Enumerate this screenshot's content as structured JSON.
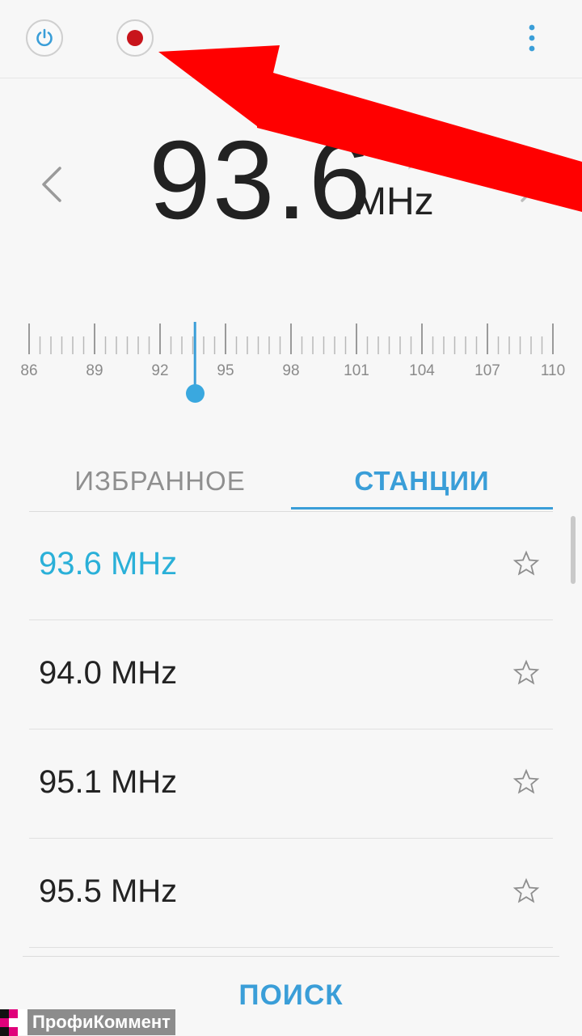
{
  "toolbar": {
    "power_icon": "power-icon",
    "record_icon": "record-icon",
    "more_icon": "more-vertical-icon"
  },
  "tuner": {
    "frequency": "93.6",
    "unit": "MHz",
    "scale_labels": [
      "86",
      "89",
      "92",
      "95",
      "98",
      "101",
      "104",
      "107",
      "110"
    ],
    "scale_min": 86,
    "scale_max": 110,
    "current": 93.6,
    "accent": "#3a9ed8"
  },
  "tabs": {
    "favorites": "ИЗБРАННОЕ",
    "stations": "СТАНЦИИ",
    "selected": "stations"
  },
  "stations": [
    {
      "label": "93.6 MHz",
      "active": true
    },
    {
      "label": "94.0 MHz",
      "active": false
    },
    {
      "label": "95.1 MHz",
      "active": false
    },
    {
      "label": "95.5 MHz",
      "active": false
    }
  ],
  "footer": {
    "search_label": "ПОИСК"
  },
  "watermark": {
    "text": "ПрофиКоммент"
  },
  "colors": {
    "active_station": "#2ab0d8",
    "record": "#c8141b",
    "annotation_arrow": "#ff0000"
  }
}
